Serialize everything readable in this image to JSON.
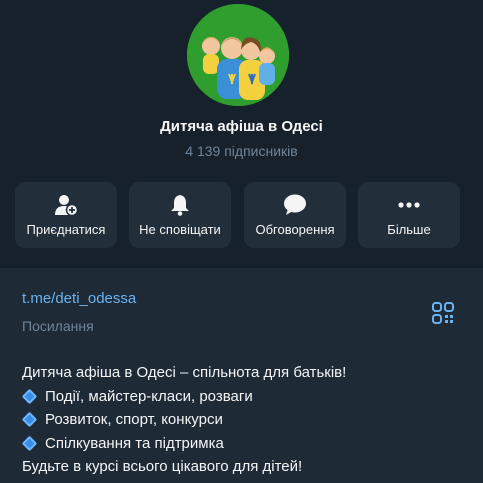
{
  "channel": {
    "title": "Дитяча афіша в Одесі",
    "subscribers": "4 139 підписників"
  },
  "actions": [
    {
      "label": "Приєднатися",
      "icon": "add-user-icon"
    },
    {
      "label": "Не сповіщати",
      "icon": "bell-icon"
    },
    {
      "label": "Обговорення",
      "icon": "chat-bubble-icon"
    },
    {
      "label": "Більше",
      "icon": "more-dots-icon"
    }
  ],
  "info": {
    "link": "t.me/deti_odessa",
    "link_label": "Посилання",
    "qr_icon": "qr-code-icon"
  },
  "description": {
    "lines": [
      "Дитяча афіша в Одесі – спільнота для батьків!",
      "Події, майстер-класи, розваги",
      "Розвиток, спорт, конкурси",
      "Спілкування та підтримка",
      "Будьте в курсі всього цікавого для дітей!"
    ],
    "bullet_icon": "blue-diamond-icon"
  },
  "colors": {
    "background": "#17212b",
    "card": "#222e3a",
    "link": "#6ab3f3",
    "muted": "#708499",
    "avatar_bg": "#2f9e2f"
  }
}
